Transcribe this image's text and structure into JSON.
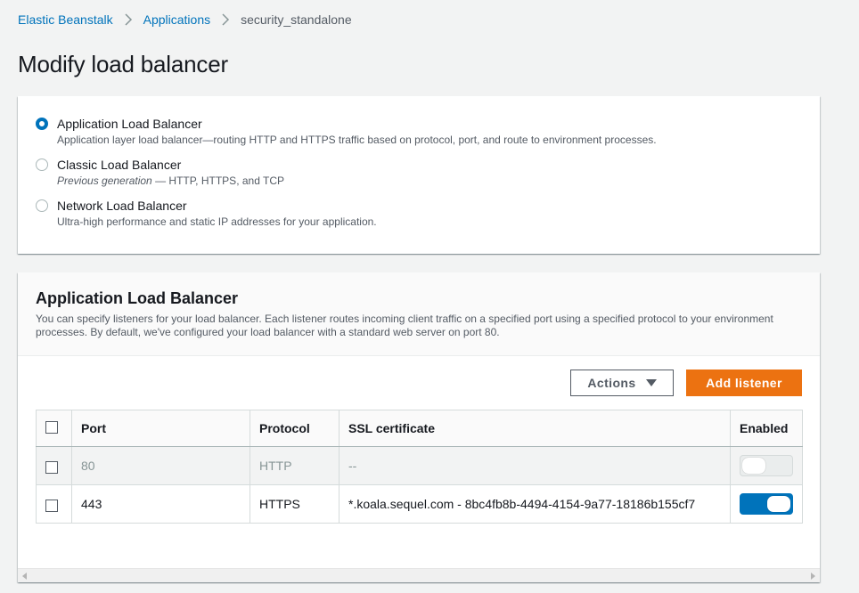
{
  "breadcrumb": {
    "items": [
      "Elastic Beanstalk",
      "Applications"
    ],
    "current": "security_standalone"
  },
  "page": {
    "title": "Modify load balancer"
  },
  "load_balancer_types": {
    "selected": "Application Load Balancer",
    "options": [
      {
        "title": "Application Load Balancer",
        "description": "Application layer load balancer—routing HTTP and HTTPS traffic based on protocol, port, and route to environment processes.",
        "checked": true
      },
      {
        "title": "Classic Load Balancer",
        "description_italic": "Previous generation",
        "description": " — HTTP, HTTPS, and TCP",
        "checked": false
      },
      {
        "title": "Network Load Balancer",
        "description": "Ultra-high performance and static IP addresses for your application.",
        "checked": false
      }
    ]
  },
  "alb": {
    "title": "Application Load Balancer",
    "description": "You can specify listeners for your load balancer. Each listener routes incoming client traffic on a specified port using a specified protocol to your environment processes. By default, we've configured your load balancer with a standard web server on port 80.",
    "actions_label": "Actions",
    "add_listener_label": "Add listener",
    "table": {
      "headers": {
        "port": "Port",
        "protocol": "Protocol",
        "ssl": "SSL certificate",
        "enabled": "Enabled"
      },
      "rows": [
        {
          "port": "80",
          "protocol": "HTTP",
          "ssl": "--",
          "enabled": false,
          "disabled": true
        },
        {
          "port": "443",
          "protocol": "HTTPS",
          "ssl": "*.koala.sequel.com - 8bc4fb8b-4494-4154-9a77-18186b155cf7",
          "enabled": true,
          "disabled": false
        }
      ]
    }
  },
  "colors": {
    "link": "#0073bb",
    "primary_button": "#ec7211",
    "toggle_on": "#0073bb"
  },
  "icons": {
    "breadcrumb_separator": "chevron-right-icon",
    "actions_caret": "caret-down-icon"
  }
}
